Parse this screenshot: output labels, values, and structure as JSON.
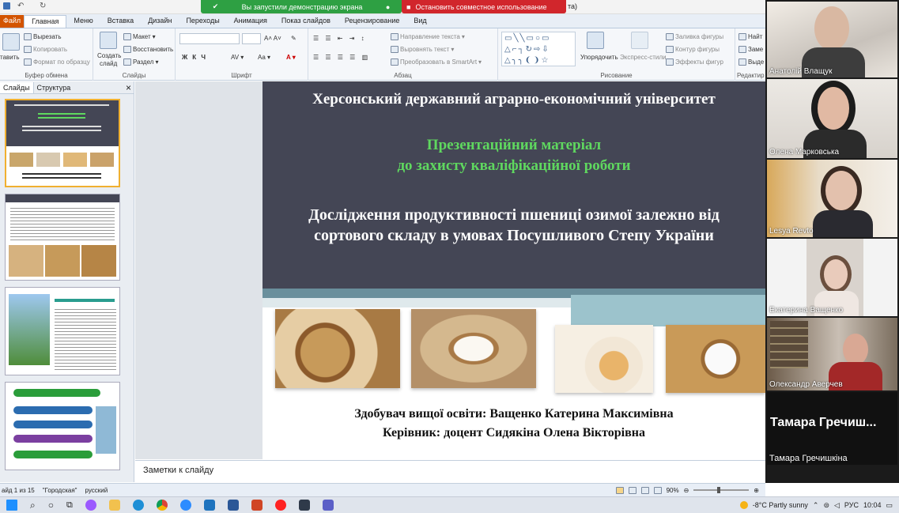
{
  "titlebar": {
    "share_status": "Вы запустили демонстрацию экрана",
    "stop_label": "Остановить совместное использование",
    "title_fragment": "та)"
  },
  "tabs": [
    "Файл",
    "Главная",
    "Меню",
    "Вставка",
    "Дизайн",
    "Переходы",
    "Анимация",
    "Показ слайдов",
    "Рецензирование",
    "Вид"
  ],
  "ribbon": {
    "clipboard": {
      "paste": "тавить",
      "cut": "Вырезать",
      "copy": "Копировать",
      "format": "Формат по образцу",
      "label": "Буфер обмена"
    },
    "slides": {
      "new": "Создать",
      "new2": "слайд",
      "layout": "Макет",
      "reset": "Восстановить",
      "section": "Раздел",
      "label": "Слайды"
    },
    "font": {
      "label": "Шрифт"
    },
    "paragraph": {
      "direction": "Направление текста",
      "align": "Выровнять текст",
      "smartart": "Преобразовать в SmartArt",
      "label": "Абзац"
    },
    "drawing": {
      "arrange": "Упорядочить",
      "styles": "Экспресс-стили",
      "fill": "Заливка фигуры",
      "outline": "Контур фигуры",
      "effects": "Эффекты фигур",
      "label": "Рисование"
    },
    "editing": {
      "find": "Найт",
      "replace": "Заме",
      "select": "Выде",
      "label": "Редактир"
    }
  },
  "left_pane": {
    "tab_slides": "Слайды",
    "tab_structure": "Структура",
    "close": "×"
  },
  "slide": {
    "university": "Херсонський державний аграрно-економічний університет",
    "presentation_line1": "Презентаційний матеріал",
    "presentation_line2": "до захисту кваліфікаційної роботи",
    "topic_line1": "Дослідження продуктивності пшениці озимої залежно від",
    "topic_line2": "сортового складу в умовах Посушливого Степу України",
    "student": "Здобувач вищої освіти: Ващенко Катерина Максимівна",
    "supervisor": "Керівник: доцент Сидякіна Олена Вікторівна"
  },
  "notes": {
    "placeholder": "Заметки к слайду"
  },
  "status": {
    "slide_counter": "айд 1 из 15",
    "theme": "\"Городская\"",
    "language": "русский",
    "zoom": "90%"
  },
  "participants": [
    {
      "name": "Анатолій Влащук"
    },
    {
      "name": "Олена Марковська"
    },
    {
      "name": "Lesya Revto"
    },
    {
      "name": "Екатерина Ващенко"
    },
    {
      "name": "Олександр Аверчев"
    },
    {
      "name": "Тамара Гречишкіна",
      "display": "Тамара  Гречиш..."
    }
  ],
  "taskbar": {
    "weather": "-8°C  Partly sunny",
    "lang": "РУС",
    "time": "10:04"
  },
  "colors": {
    "slide_dark": "#444655",
    "slide_green": "#5fd85f",
    "share_green": "#2ea043",
    "stop_red": "#d1262c",
    "file_tab": "#d35400"
  }
}
